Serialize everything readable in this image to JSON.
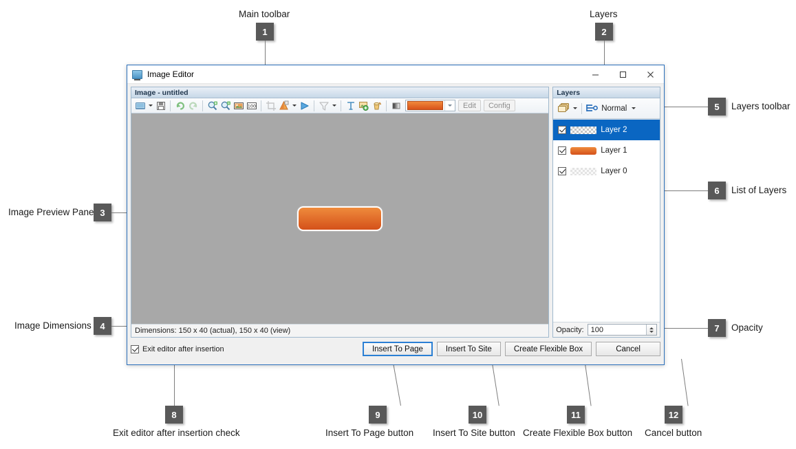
{
  "window": {
    "title": "Image Editor",
    "icon": "monitor-image-icon",
    "minimize_label": "–",
    "maximize_label": "□",
    "close_label": "✕"
  },
  "image_panel": {
    "caption": "Image - untitled",
    "toolbar_items": [
      {
        "name": "open-image-icon",
        "label": "Open"
      },
      {
        "name": "open-dropdown-arrow",
        "label": "Open options"
      },
      {
        "name": "save-icon",
        "label": "Save"
      },
      {
        "name": "undo-icon",
        "label": "Undo"
      },
      {
        "name": "redo-icon",
        "label": "Redo"
      },
      {
        "name": "zoom-in-icon",
        "label": "Zoom In"
      },
      {
        "name": "zoom-out-icon",
        "label": "Zoom Out"
      },
      {
        "name": "fit-to-window-icon",
        "label": "Fit To Window"
      },
      {
        "name": "zoom-100-icon",
        "label": "Zoom 100%"
      },
      {
        "name": "crop-icon",
        "label": "Crop"
      },
      {
        "name": "gradient-fill-icon",
        "label": "Gradient Fill"
      },
      {
        "name": "gradient-dropdown-arrow",
        "label": "Gradient options"
      },
      {
        "name": "shape-icon",
        "label": "Shape"
      },
      {
        "name": "filter-icon",
        "label": "Filter"
      },
      {
        "name": "filter-dropdown-arrow",
        "label": "Filter options"
      },
      {
        "name": "text-tool-icon",
        "label": "Text"
      },
      {
        "name": "add-image-icon",
        "label": "Add Image"
      },
      {
        "name": "paint-bucket-icon",
        "label": "Fill"
      },
      {
        "name": "gradient-preview-icon",
        "label": "Gradient Preview"
      }
    ],
    "color_combo": {
      "name": "color-swatch",
      "value": "#e8732b"
    },
    "edit_button": "Edit",
    "config_button": "Config",
    "status": "Dimensions: 150 x 40 (actual),  150 x 40 (view)",
    "canvas_button_color": "#e07020"
  },
  "layers_panel": {
    "caption": "Layers",
    "toolbar": {
      "new_layer_icon": "new-layer-icon",
      "new_layer_dropdown": "new-layer-dropdown-arrow",
      "blend_icon": "blend-mode-icon",
      "blend_mode": "Normal",
      "blend_dropdown": "blend-mode-dropdown-arrow"
    },
    "layers": [
      {
        "name": "Layer 2",
        "checked": true,
        "selected": true,
        "thumb": "checker"
      },
      {
        "name": "Layer 1",
        "checked": true,
        "selected": false,
        "thumb": "orange"
      },
      {
        "name": "Layer 0",
        "checked": true,
        "selected": false,
        "thumb": "checker-faint"
      }
    ],
    "opacity_label": "Opacity:",
    "opacity_value": "100"
  },
  "footer": {
    "exit_checkbox_label": "Exit editor after insertion",
    "exit_checkbox_checked": true,
    "buttons": [
      {
        "label": "Insert To Page",
        "default": true
      },
      {
        "label": "Insert To Site",
        "default": false
      },
      {
        "label": "Create Flexible Box",
        "default": false
      },
      {
        "label": "Cancel",
        "default": false
      }
    ]
  },
  "annotations": [
    {
      "number": "1",
      "label": "Main toolbar"
    },
    {
      "number": "2",
      "label": "Layers"
    },
    {
      "number": "3",
      "label": "Image Preview Pane"
    },
    {
      "number": "4",
      "label": "Image Dimensions"
    },
    {
      "number": "5",
      "label": "Layers toolbar"
    },
    {
      "number": "6",
      "label": "List of Layers"
    },
    {
      "number": "7",
      "label": "Opacity"
    },
    {
      "number": "8",
      "label": "Exit editor after insertion check"
    },
    {
      "number": "9",
      "label": "Insert To Page button"
    },
    {
      "number": "10",
      "label": "Insert To Site button"
    },
    {
      "number": "11",
      "label": "Create Flexible Box button"
    },
    {
      "number": "12",
      "label": "Cancel button"
    }
  ],
  "colors": {
    "accent": "#0a66c2",
    "orange": "#e07020",
    "badge": "#595959",
    "window_border": "#2a6fbb"
  }
}
